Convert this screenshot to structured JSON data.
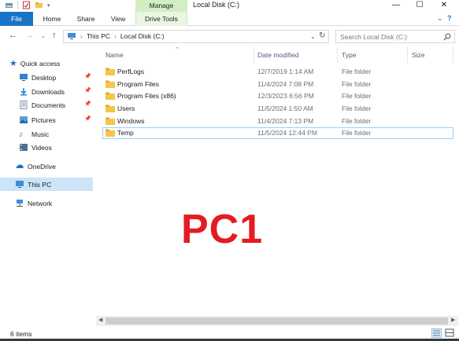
{
  "window": {
    "title": "Local Disk (C:)",
    "minimize_glyph": "—",
    "maximize_glyph": "☐",
    "close_glyph": "✕"
  },
  "ribbon": {
    "tabs": [
      "File",
      "Home",
      "Share",
      "View"
    ],
    "context_group": "Manage",
    "context_tab": "Drive Tools",
    "expand_glyph": "⌄",
    "help_glyph": "?"
  },
  "address": {
    "path": [
      "This PC",
      "Local Disk (C:)"
    ],
    "separator": "›",
    "dropdown_glyph": "⌄",
    "refresh_glyph": "↻",
    "search_placeholder": "Search Local Disk (C:)",
    "back_glyph": "←",
    "forward_glyph": "→",
    "recent_glyph": "⌄",
    "up_glyph": "↑"
  },
  "nav": {
    "quick_access": "Quick access",
    "pinned": [
      {
        "label": "Desktop",
        "icon": "desktop-icon"
      },
      {
        "label": "Downloads",
        "icon": "downloads-icon"
      },
      {
        "label": "Documents",
        "icon": "documents-icon"
      },
      {
        "label": "Pictures",
        "icon": "pictures-icon"
      }
    ],
    "music": "Music",
    "videos": "Videos",
    "onedrive": "OneDrive",
    "this_pc": "This PC",
    "network": "Network",
    "pin_glyph": "📌"
  },
  "columns": {
    "name": "Name",
    "date": "Date modified",
    "type": "Type",
    "size": "Size"
  },
  "files": [
    {
      "name": "PerfLogs",
      "date": "12/7/2019 1:14 AM",
      "type": "File folder"
    },
    {
      "name": "Program Files",
      "date": "11/4/2024 7:08 PM",
      "type": "File folder"
    },
    {
      "name": "Program Files (x86)",
      "date": "12/3/2023 6:56 PM",
      "type": "File folder"
    },
    {
      "name": "Users",
      "date": "11/5/2024 1:50 AM",
      "type": "File folder"
    },
    {
      "name": "Windows",
      "date": "11/4/2024 7:13 PM",
      "type": "File folder"
    },
    {
      "name": "Temp",
      "date": "11/5/2024 12:44 PM",
      "type": "File folder"
    }
  ],
  "overlay_label": "PC1",
  "status": {
    "item_count": "6 items"
  },
  "colors": {
    "file_tab": "#1a74c6",
    "manage_band": "#d3edc5",
    "selection": "#cce4f7",
    "watermark": "#e41b23",
    "folder": "#f4c64e"
  }
}
